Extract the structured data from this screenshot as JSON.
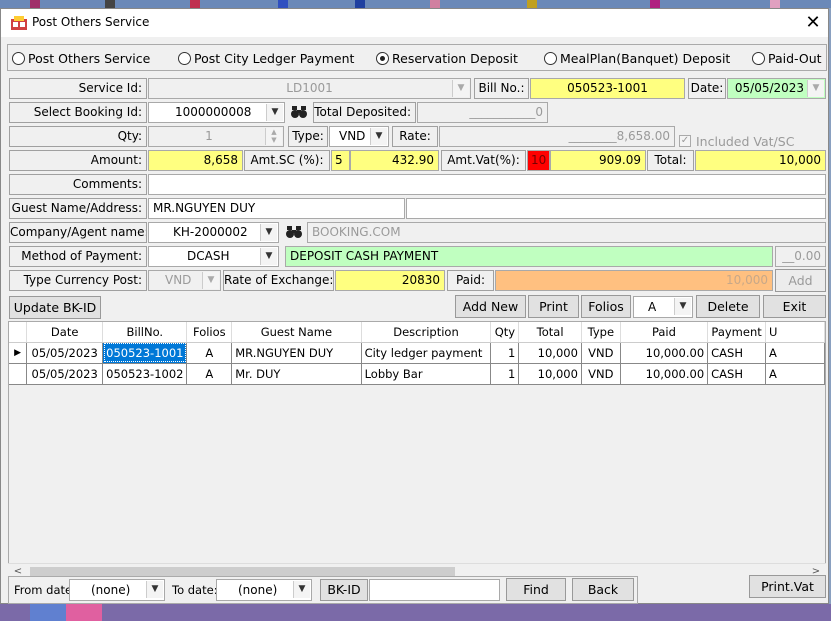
{
  "window": {
    "title": "Post Others Service",
    "close_glyph": "✕"
  },
  "modes": [
    {
      "label": "Post Others Service",
      "selected": false
    },
    {
      "label": "Post City Ledger Payment",
      "selected": false
    },
    {
      "label": "Reservation Deposit",
      "selected": true
    },
    {
      "label": "MealPlan(Banquet) Deposit",
      "selected": false
    },
    {
      "label": "Paid-Out",
      "selected": false
    }
  ],
  "form": {
    "service_id_label": "Service Id:",
    "service_id_value": "LD1001",
    "bill_no_label": "Bill No.:",
    "bill_no_value": "050523-1001",
    "date_label": "Date:",
    "date_value": "05/05/2023",
    "booking_label": "Select Booking Id:",
    "booking_value": "1000000008",
    "total_deposited_label": "Total Deposited:",
    "total_deposited_value": "___________0",
    "qty_label": "Qty:",
    "qty_value": "1",
    "type_label": "Type:",
    "type_value": "VND",
    "rate_label": "Rate:",
    "rate_value": "________8,658.00",
    "vat_checkbox_label": "Included Vat/SC",
    "vat_check_glyph": "✓",
    "amount_label": "Amount:",
    "amount_value": "8,658",
    "amt_sc_label": "Amt.SC (%):",
    "amt_sc_pct": "5",
    "amt_sc_value": "432.90",
    "amt_vat_label": "Amt.Vat(%):",
    "amt_vat_pct": "10",
    "amt_vat_value": "909.09",
    "total_label": "Total:",
    "total_value": "10,000",
    "comments_label": "Comments:",
    "comments_value": "",
    "guest_label": "Guest Name/Address:",
    "guest_name": "MR.NGUYEN DUY",
    "guest_address": "",
    "company_label": "Company/Agent name:",
    "company_code": "KH-2000002",
    "company_name": "BOOKING.COM",
    "method_label": "Method of Payment:",
    "method_code": "DCASH",
    "method_desc": "DEPOSIT CASH PAYMENT",
    "method_amount": "__0.00",
    "currency_label": "Type Currency Post:",
    "currency_value": "VND",
    "rate_exchange_label": "Rate of Exchange:",
    "rate_exchange_value": "20830",
    "paid_label": "Paid:",
    "paid_value": "10,000",
    "add_button": "Add"
  },
  "toolbar": {
    "update_bk": "Update BK-ID",
    "add_new": "Add New",
    "print": "Print",
    "folios": "Folios",
    "folio_value": "A",
    "delete": "Delete",
    "exit": "Exit"
  },
  "table": {
    "columns": [
      "Date",
      "BillNo.",
      "Folios",
      "Guest Name",
      "Description",
      "Qty",
      "Total",
      "Type",
      "Paid",
      "Payment",
      "U"
    ],
    "rows": [
      [
        "05/05/2023",
        "050523-1001",
        "A",
        "MR.NGUYEN DUY",
        "City ledger payment",
        "1",
        "10,000",
        "VND",
        "10,000.00",
        "CASH",
        "A"
      ],
      [
        "05/05/2023",
        "050523-1002",
        "A",
        "Mr. DUY",
        "Lobby Bar",
        "1",
        "10,000",
        "VND",
        "10,000.00",
        "CASH",
        "A"
      ]
    ],
    "current_row_glyph": "▶",
    "scroll_left": "<",
    "scroll_right": ">"
  },
  "filter": {
    "from_label": "From date:",
    "from_value": "(none)",
    "to_label": "To date:",
    "to_value": "(none)",
    "bkid_label": "BK-ID",
    "bkid_value": "",
    "find": "Find",
    "back": "Back",
    "print_vat": "Print.Vat"
  },
  "colors": {
    "yellow": "#ffff80",
    "green": "#c0ffc0",
    "orange": "#ffc080",
    "red": "#ff0000",
    "selection": "#0078d7"
  }
}
